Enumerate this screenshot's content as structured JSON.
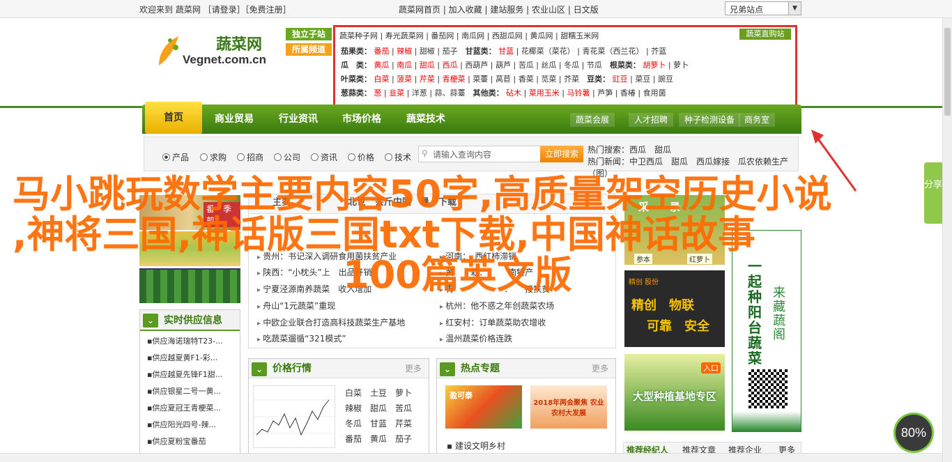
{
  "topbar": {
    "welcome": "欢迎来到 蔬菜网 ［请登录］［免费注册］",
    "links": "蔬菜网首页 | 加入收藏 | 建站服务 | 农业山区 | 日文版",
    "site_select": "兄弟站点"
  },
  "logo": {
    "cn": "蔬菜网",
    "en": "Vegnet.com.cn"
  },
  "subsites": [
    "独立子站",
    "所属频道"
  ],
  "navbox": {
    "row1": [
      "蔬菜种子网",
      "寿光蔬菜网",
      "番茄网",
      "南瓜网",
      "西甜瓜网",
      "黄瓜网",
      "甜糯玉米网"
    ],
    "buy_button": "蔬菜直购站",
    "rows": [
      {
        "label": "茄果类：",
        "items": [
          "番茄",
          "辣椒",
          "甜椒",
          "茄子"
        ],
        "label2": "甘蓝类：",
        "items2": [
          "甘蓝",
          "花椰菜（菜花）",
          "青花菜（西兰花）",
          "芥蓝"
        ]
      },
      {
        "label": "瓜　类：",
        "items": [
          "黄瓜",
          "南瓜",
          "甜瓜",
          "西瓜",
          "西葫芦",
          "葫芦",
          "苦瓜",
          "丝瓜",
          "冬瓜",
          "节瓜"
        ],
        "label2": "根菜类：",
        "items2": [
          "胡萝卜",
          "萝卜"
        ]
      },
      {
        "label": "叶菜类：",
        "items": [
          "白菜",
          "菠菜",
          "芹菜",
          "青梗菜",
          "菜薹",
          "莴苣",
          "香菜",
          "苋菜",
          "芥菜"
        ],
        "label2": "豆类：",
        "items2": [
          "豇豆",
          "菜豆",
          "豌豆"
        ]
      },
      {
        "label": "葱蒜类：",
        "items": [
          "葱",
          "韭菜",
          "洋葱",
          "蒜、蒜薹"
        ],
        "label2": "其他类：",
        "items2": [
          "砧木",
          "菜用玉米",
          "马铃薯",
          "芦笋",
          "香椿",
          "食用菌"
        ]
      }
    ]
  },
  "mainnav": {
    "items": [
      "首页",
      "商业贸易",
      "行业资讯",
      "市场价格",
      "蔬菜技术"
    ],
    "sub": [
      "蔬菜会展",
      "人才招聘",
      "种子检测设备",
      "商务室"
    ]
  },
  "search": {
    "options": [
      "产品",
      "求购",
      "招商",
      "公司",
      "资讯",
      "价格",
      "技术"
    ],
    "placeholder": "请输入查询内容",
    "button": "立即搜索",
    "hot_label": "热门搜索：",
    "hot": "西瓜　甜瓜",
    "news_label": "热门新闻：",
    "news": "中卫西瓜　甜瓜　西瓜嫁接　瓜农依赖生产（图）"
  },
  "left": {
    "banner": "番　季剪",
    "supply_title": "实时供应信息",
    "supply": [
      "供应海诺瑞特T23-...",
      "供应越夏黄F1-彩...",
      "供应越夏先锋F1甜...",
      "供应银星二号一黄...",
      "供应夏冠王青梗菜...",
      "供应阳光四号-辣...",
      "供应夏粉宝番茄"
    ]
  },
  "news": {
    "tab_left": "主要",
    "tab_center": "北世　会斤中国　暑　下载",
    "left": [
      "贵州：书记深入调研食用菌扶贫产业",
      "陕西：“小枕头”上　出品开销",
      "宁夏泾源南养蔬菜　收入增加",
      "舟山“1元蔬菜”重现",
      "中欧企业联合打造高科技蔬菜生产基地",
      "吃蔬菜遛循“321模式”"
    ],
    "right": [
      "河南：　西红柿滞销",
      "黄　　栽：　　　南特产",
      "青　　　　　　：　　接扶贫",
      "杭州：他不惑之年创蔬菜农场",
      "红安村：订单蔬菜助农增收",
      "温州蔬菜价格连跌"
    ]
  },
  "price": {
    "title": "价格行情",
    "more": "更多",
    "vegs": [
      "白菜",
      "土豆",
      "萝卜",
      "辣椒",
      "甜瓜",
      "苦瓜",
      "冬瓜",
      "甘蓝",
      "芹菜",
      "番茄",
      "黄瓜",
      "茄子"
    ]
  },
  "hotspot": {
    "title": "热点专题",
    "more": "更多",
    "img1": "盈可泰",
    "img2": "2018年两会聚焦 农业农村大发展",
    "link": "建设文明乡村"
  },
  "ads": {
    "a1": "采　　录",
    "a1b": "参本",
    "a1c": "红萝卜",
    "a2a": "精创 股份",
    "a2b": "精创　物联",
    "a2c": "可靠　安全",
    "a3": "大型种植基地专区",
    "a3b": "入口",
    "tall1": "一起种阳台蔬菜",
    "tall2": "来藏蔬阁",
    "bottom_tabs": [
      "推荐经纪人",
      "推荐文章",
      "推荐企业",
      "更多"
    ]
  },
  "sidebar": {
    "share": "分享"
  },
  "gauge": "80%",
  "overlay": {
    "line1": "马小跳玩数学主要内容50字,高质量架空历史小说",
    "line2": ",神将三国,神话版三国txt下载,中国神话故事",
    "line3": "100篇英文版"
  },
  "colors": {
    "brand_green": "#4a8a1a",
    "accent_orange": "#ff6a00",
    "highlight_red": "#e03030"
  }
}
